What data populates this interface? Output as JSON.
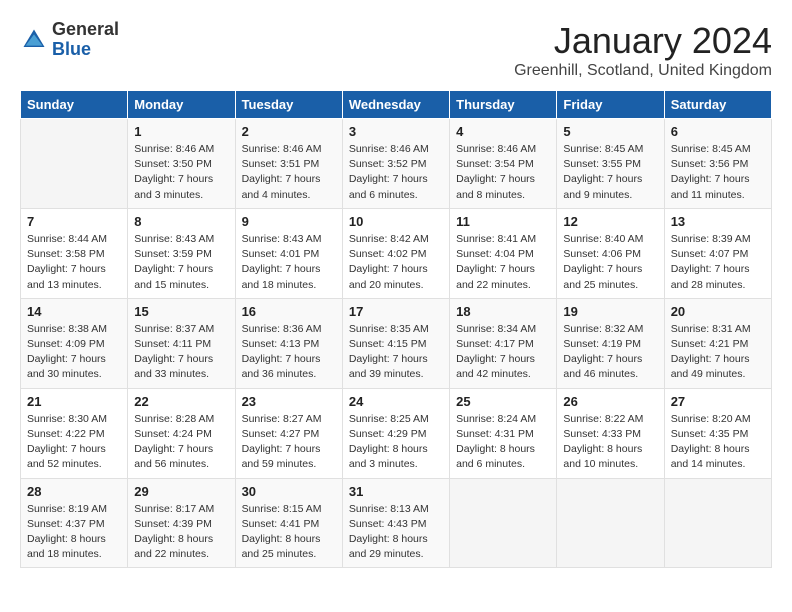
{
  "header": {
    "logo_general": "General",
    "logo_blue": "Blue",
    "title": "January 2024",
    "location": "Greenhill, Scotland, United Kingdom"
  },
  "days_of_week": [
    "Sunday",
    "Monday",
    "Tuesday",
    "Wednesday",
    "Thursday",
    "Friday",
    "Saturday"
  ],
  "weeks": [
    [
      {
        "day": "",
        "info": ""
      },
      {
        "day": "1",
        "info": "Sunrise: 8:46 AM\nSunset: 3:50 PM\nDaylight: 7 hours\nand 3 minutes."
      },
      {
        "day": "2",
        "info": "Sunrise: 8:46 AM\nSunset: 3:51 PM\nDaylight: 7 hours\nand 4 minutes."
      },
      {
        "day": "3",
        "info": "Sunrise: 8:46 AM\nSunset: 3:52 PM\nDaylight: 7 hours\nand 6 minutes."
      },
      {
        "day": "4",
        "info": "Sunrise: 8:46 AM\nSunset: 3:54 PM\nDaylight: 7 hours\nand 8 minutes."
      },
      {
        "day": "5",
        "info": "Sunrise: 8:45 AM\nSunset: 3:55 PM\nDaylight: 7 hours\nand 9 minutes."
      },
      {
        "day": "6",
        "info": "Sunrise: 8:45 AM\nSunset: 3:56 PM\nDaylight: 7 hours\nand 11 minutes."
      }
    ],
    [
      {
        "day": "7",
        "info": "Sunrise: 8:44 AM\nSunset: 3:58 PM\nDaylight: 7 hours\nand 13 minutes."
      },
      {
        "day": "8",
        "info": "Sunrise: 8:43 AM\nSunset: 3:59 PM\nDaylight: 7 hours\nand 15 minutes."
      },
      {
        "day": "9",
        "info": "Sunrise: 8:43 AM\nSunset: 4:01 PM\nDaylight: 7 hours\nand 18 minutes."
      },
      {
        "day": "10",
        "info": "Sunrise: 8:42 AM\nSunset: 4:02 PM\nDaylight: 7 hours\nand 20 minutes."
      },
      {
        "day": "11",
        "info": "Sunrise: 8:41 AM\nSunset: 4:04 PM\nDaylight: 7 hours\nand 22 minutes."
      },
      {
        "day": "12",
        "info": "Sunrise: 8:40 AM\nSunset: 4:06 PM\nDaylight: 7 hours\nand 25 minutes."
      },
      {
        "day": "13",
        "info": "Sunrise: 8:39 AM\nSunset: 4:07 PM\nDaylight: 7 hours\nand 28 minutes."
      }
    ],
    [
      {
        "day": "14",
        "info": "Sunrise: 8:38 AM\nSunset: 4:09 PM\nDaylight: 7 hours\nand 30 minutes."
      },
      {
        "day": "15",
        "info": "Sunrise: 8:37 AM\nSunset: 4:11 PM\nDaylight: 7 hours\nand 33 minutes."
      },
      {
        "day": "16",
        "info": "Sunrise: 8:36 AM\nSunset: 4:13 PM\nDaylight: 7 hours\nand 36 minutes."
      },
      {
        "day": "17",
        "info": "Sunrise: 8:35 AM\nSunset: 4:15 PM\nDaylight: 7 hours\nand 39 minutes."
      },
      {
        "day": "18",
        "info": "Sunrise: 8:34 AM\nSunset: 4:17 PM\nDaylight: 7 hours\nand 42 minutes."
      },
      {
        "day": "19",
        "info": "Sunrise: 8:32 AM\nSunset: 4:19 PM\nDaylight: 7 hours\nand 46 minutes."
      },
      {
        "day": "20",
        "info": "Sunrise: 8:31 AM\nSunset: 4:21 PM\nDaylight: 7 hours\nand 49 minutes."
      }
    ],
    [
      {
        "day": "21",
        "info": "Sunrise: 8:30 AM\nSunset: 4:22 PM\nDaylight: 7 hours\nand 52 minutes."
      },
      {
        "day": "22",
        "info": "Sunrise: 8:28 AM\nSunset: 4:24 PM\nDaylight: 7 hours\nand 56 minutes."
      },
      {
        "day": "23",
        "info": "Sunrise: 8:27 AM\nSunset: 4:27 PM\nDaylight: 7 hours\nand 59 minutes."
      },
      {
        "day": "24",
        "info": "Sunrise: 8:25 AM\nSunset: 4:29 PM\nDaylight: 8 hours\nand 3 minutes."
      },
      {
        "day": "25",
        "info": "Sunrise: 8:24 AM\nSunset: 4:31 PM\nDaylight: 8 hours\nand 6 minutes."
      },
      {
        "day": "26",
        "info": "Sunrise: 8:22 AM\nSunset: 4:33 PM\nDaylight: 8 hours\nand 10 minutes."
      },
      {
        "day": "27",
        "info": "Sunrise: 8:20 AM\nSunset: 4:35 PM\nDaylight: 8 hours\nand 14 minutes."
      }
    ],
    [
      {
        "day": "28",
        "info": "Sunrise: 8:19 AM\nSunset: 4:37 PM\nDaylight: 8 hours\nand 18 minutes."
      },
      {
        "day": "29",
        "info": "Sunrise: 8:17 AM\nSunset: 4:39 PM\nDaylight: 8 hours\nand 22 minutes."
      },
      {
        "day": "30",
        "info": "Sunrise: 8:15 AM\nSunset: 4:41 PM\nDaylight: 8 hours\nand 25 minutes."
      },
      {
        "day": "31",
        "info": "Sunrise: 8:13 AM\nSunset: 4:43 PM\nDaylight: 8 hours\nand 29 minutes."
      },
      {
        "day": "",
        "info": ""
      },
      {
        "day": "",
        "info": ""
      },
      {
        "day": "",
        "info": ""
      }
    ]
  ]
}
